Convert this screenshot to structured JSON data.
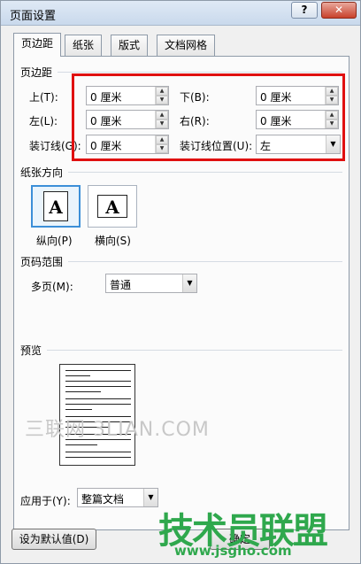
{
  "window": {
    "title": "页面设置"
  },
  "titlebar": {
    "help": "?",
    "close": "✕"
  },
  "tabs": [
    {
      "label": "页边距"
    },
    {
      "label": "纸张"
    },
    {
      "label": "版式"
    },
    {
      "label": "文档网格"
    }
  ],
  "margins": {
    "group_title": "页边距",
    "top_label": "上(T):",
    "top_value": "0 厘米",
    "bottom_label": "下(B):",
    "bottom_value": "0 厘米",
    "left_label": "左(L):",
    "left_value": "0 厘米",
    "right_label": "右(R):",
    "right_value": "0 厘米",
    "gutter_label": "装订线(G):",
    "gutter_value": "0 厘米",
    "gutter_pos_label": "装订线位置(U):",
    "gutter_pos_value": "左"
  },
  "orientation": {
    "group_title": "纸张方向",
    "portrait_label": "纵向(P)",
    "landscape_label": "横向(S)",
    "icon_letter": "A",
    "selected": "portrait"
  },
  "pages": {
    "group_title": "页码范围",
    "multiple_label": "多页(M):",
    "multiple_value": "普通"
  },
  "preview": {
    "group_title": "预览",
    "apply_label": "应用于(Y):",
    "apply_value": "整篇文档"
  },
  "footer": {
    "default_button": "设为默认值(D)",
    "ok_button": "确定"
  },
  "watermarks": {
    "gray": "三联网 3LIAN.COM",
    "logo": "技术员联盟",
    "url": "www.jsgho.com"
  },
  "colors": {
    "highlight_box": "#e01010",
    "watermark_green": "#2fa84d"
  }
}
